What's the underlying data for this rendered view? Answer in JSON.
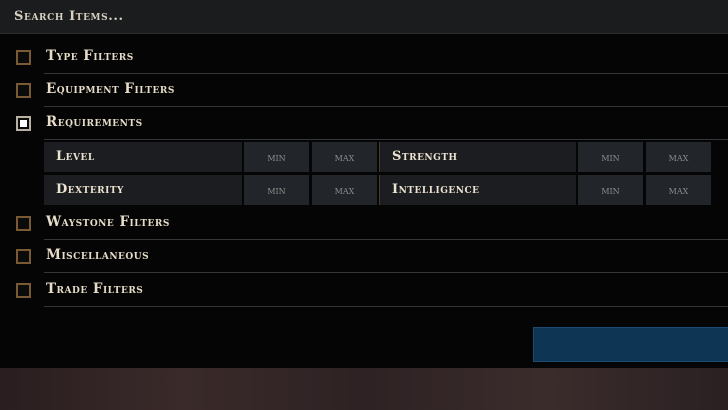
{
  "search": {
    "placeholder": "Search Items..."
  },
  "filters": [
    {
      "label": "Type Filters",
      "checked": false
    },
    {
      "label": "Equipment Filters",
      "checked": false
    },
    {
      "label": "Requirements",
      "checked": true
    },
    {
      "label": "Waystone Filters",
      "checked": false
    },
    {
      "label": "Miscellaneous",
      "checked": false
    },
    {
      "label": "Trade Filters",
      "checked": false
    }
  ],
  "requirements": {
    "min_placeholder": "min",
    "max_placeholder": "max",
    "stats": [
      {
        "label": "Level"
      },
      {
        "label": "Strength"
      },
      {
        "label": "Dexterity"
      },
      {
        "label": "Intelligence"
      }
    ]
  },
  "colors": {
    "accent_button": "#0f3554",
    "checkbox_border": "#7a5a34",
    "label_text": "#e6dcc8"
  }
}
